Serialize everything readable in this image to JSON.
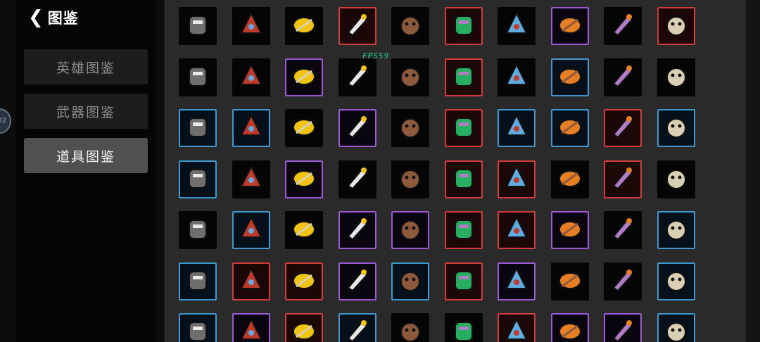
{
  "header": {
    "title": "图鉴"
  },
  "nav": [
    {
      "label": "英雄图鉴",
      "active": false
    },
    {
      "label": "武器图鉴",
      "active": false
    },
    {
      "label": "道具图鉴",
      "active": true
    }
  ],
  "edge_badge": "22",
  "overlay": {
    "fps_text": "FPS59"
  },
  "rarity_colors": {
    "purple": "#9b57d6",
    "red": "#d33b3b",
    "blue": "#3e97cf",
    "gray": "#050505"
  },
  "items": [
    [
      "gray",
      "gray",
      "gray",
      "red",
      "gray",
      "red",
      "gray",
      "purple",
      "gray",
      "red"
    ],
    [
      "gray",
      "gray",
      "purple",
      "gray",
      "gray",
      "red",
      "gray",
      "blue",
      "gray",
      "gray"
    ],
    [
      "blue",
      "blue",
      "gray",
      "purple",
      "gray",
      "red",
      "blue",
      "blue",
      "red",
      "blue"
    ],
    [
      "blue",
      "gray",
      "purple",
      "gray",
      "gray",
      "red",
      "red",
      "gray",
      "red",
      "gray"
    ],
    [
      "gray",
      "blue",
      "gray",
      "purple",
      "purple",
      "red",
      "red",
      "purple",
      "gray",
      "blue"
    ],
    [
      "blue",
      "red",
      "red",
      "purple",
      "blue",
      "red",
      "purple",
      "gray",
      "gray",
      "blue"
    ],
    [
      "blue",
      "purple",
      "red",
      "blue",
      "gray",
      "gray",
      "red",
      "purple",
      "purple",
      "blue"
    ]
  ]
}
